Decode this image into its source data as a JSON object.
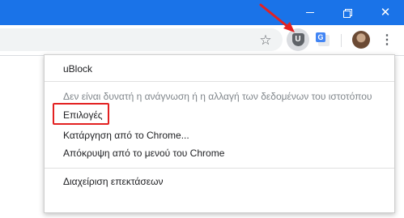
{
  "window": {
    "minimize_icon": "minimize-icon",
    "maximize_icon": "restore-icon",
    "close_icon": "close-icon",
    "close_glyph": "✕"
  },
  "toolbar": {
    "star_glyph": "☆",
    "ublock_letter": "U",
    "translate_letter": "G",
    "menu_glyph": "⋮"
  },
  "context_menu": {
    "title": "uBlock",
    "disabled_notice": "Δεν είναι δυνατή η ανάγνωση ή η αλλαγή των δεδομένων του ιστοτόπου",
    "options": "Επιλογές",
    "remove": "Κατάργηση από το Chrome...",
    "hide": "Απόκρυψη από το μενού του Chrome",
    "manage": "Διαχείριση επεκτάσεων"
  },
  "colors": {
    "titlebar": "#1a73e8",
    "annotation": "#e32121",
    "disabled_text": "#80868b"
  }
}
